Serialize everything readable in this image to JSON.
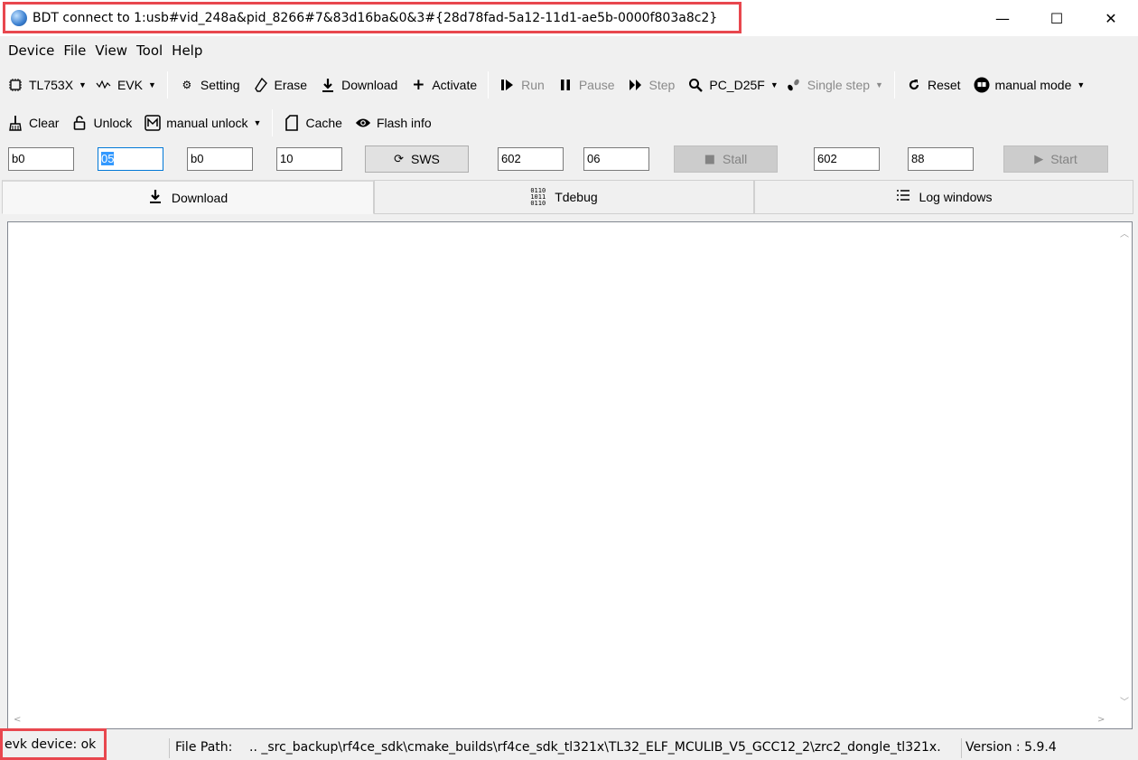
{
  "window": {
    "title": "BDT connect to 1:usb#vid_248a&pid_8266#7&83d16ba&0&3#{28d78fad-5a12-11d1-ae5b-0000f803a8c2}",
    "minimize_glyph": "—",
    "maximize_glyph": "☐",
    "close_glyph": "✕",
    "accent_color": "#e8474e"
  },
  "menu": {
    "items": [
      "Device",
      "File",
      "View",
      "Tool",
      "Help"
    ]
  },
  "toolbar1": {
    "chip": {
      "icon": "chip-icon",
      "label": "TL753X"
    },
    "board": {
      "icon": "waveform-icon",
      "label": "EVK"
    },
    "setting": {
      "icon": "gear-icon",
      "label": "Setting"
    },
    "erase": {
      "icon": "eraser-icon",
      "label": "Erase"
    },
    "download": {
      "icon": "download-icon",
      "label": "Download"
    },
    "activate": {
      "icon": "plus-icon",
      "label": "Activate"
    },
    "run": {
      "icon": "run-icon",
      "label": "Run"
    },
    "pause": {
      "icon": "pause-icon",
      "label": "Pause"
    },
    "step": {
      "icon": "step-icon",
      "label": "Step"
    },
    "pc": {
      "icon": "magnifier-icon",
      "label": "PC_D25F"
    },
    "single_step": {
      "icon": "footsteps-icon",
      "label": "Single step"
    },
    "reset": {
      "icon": "reset-icon",
      "label": "Reset"
    },
    "mode": {
      "icon": "mode-icon",
      "label": "manual mode"
    }
  },
  "toolbar2": {
    "clear": {
      "icon": "broom-icon",
      "label": "Clear"
    },
    "unlock": {
      "icon": "unlock-icon",
      "label": "Unlock"
    },
    "manual_unlock": {
      "icon": "manual-unlock-icon",
      "label": "manual unlock"
    },
    "cache": {
      "icon": "sd-card-icon",
      "label": "Cache"
    },
    "flash_info": {
      "icon": "eye-icon",
      "label": "Flash info"
    }
  },
  "inputs": {
    "f1": "b0",
    "f2": "05",
    "f3": "b0",
    "f4": "10",
    "sws_label": "SWS",
    "f5": "602",
    "f6": "06",
    "stall_label": "Stall",
    "f7": "602",
    "f8": "88",
    "start_label": "Start"
  },
  "tabs": [
    {
      "label": "Download",
      "icon": "download-icon"
    },
    {
      "label": "Tdebug",
      "icon": "binary-icon"
    },
    {
      "label": "Log windows",
      "icon": "list-icon"
    }
  ],
  "status": {
    "device": "evk device: ok",
    "file_path_label": "File Path:",
    "file_path": "..  _src_backup\\rf4ce_sdk\\cmake_builds\\rf4ce_sdk_tl321x\\TL32_ELF_MCULIB_V5_GCC12_2\\zrc2_dongle_tl321x.",
    "version": "Version : 5.9.4"
  }
}
